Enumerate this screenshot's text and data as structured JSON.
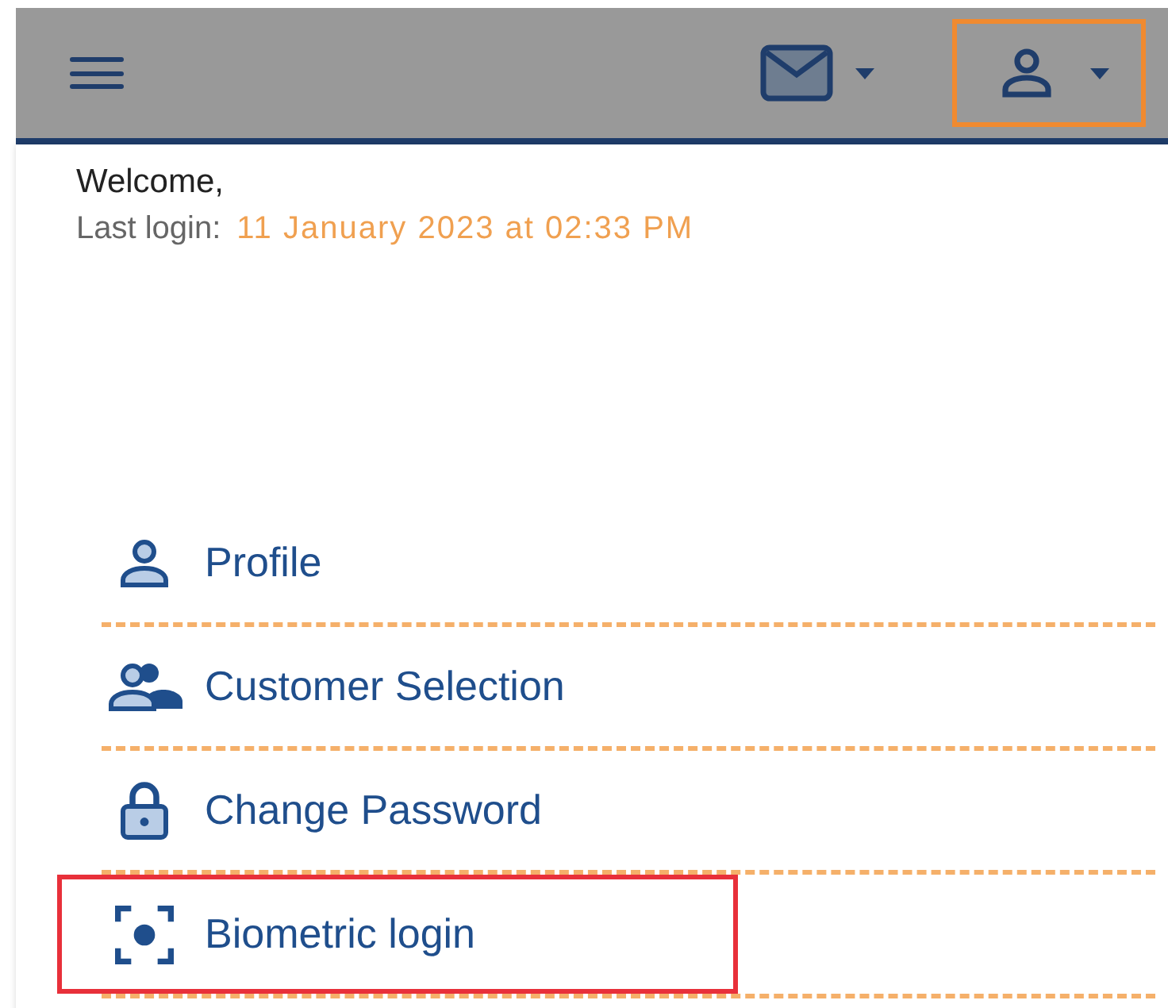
{
  "top_bar": {
    "mail_button": {
      "highlighted": false
    },
    "user_button": {
      "highlighted": true
    }
  },
  "account_panel": {
    "welcome": "Welcome,",
    "last_login_label": "Last login:",
    "last_login_value": "11 January 2023 at 02:33 PM"
  },
  "menu": [
    {
      "kind": "profile",
      "label": "Profile",
      "highlighted": false
    },
    {
      "kind": "customers",
      "label": "Customer Selection",
      "highlighted": false
    },
    {
      "kind": "password",
      "label": "Change Password",
      "highlighted": false
    },
    {
      "kind": "biometric",
      "label": "Biometric login",
      "highlighted": true
    }
  ]
}
